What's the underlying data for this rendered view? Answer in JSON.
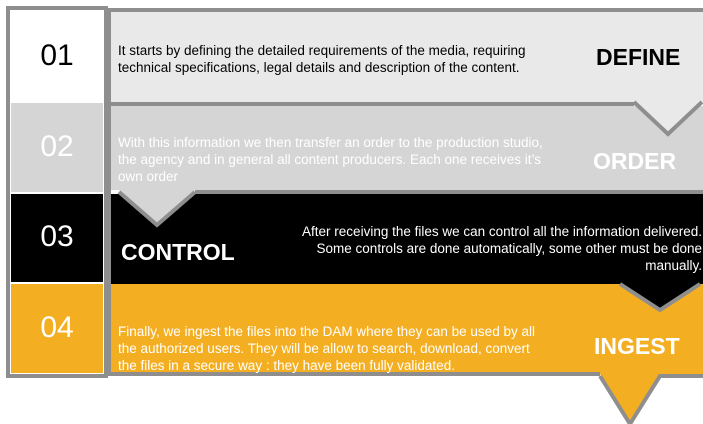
{
  "steps": [
    {
      "number": "01",
      "title": "DEFINE",
      "text": "It starts by defining the detailed requirements of the media, requiring technical specifications, legal details and description of the content."
    },
    {
      "number": "02",
      "title": "ORDER",
      "text": "With this information we then transfer an order to the production studio, the agency and in general all content producers. Each one receives it’s own order"
    },
    {
      "number": "03",
      "title": "CONTROL",
      "text": "After receiving the files we can control all the information delivered. Some controls are done automatically, some other must be done manually."
    },
    {
      "number": "04",
      "title": "INGEST",
      "text": "Finally, we ingest the files into the DAM where they can be used by all the authorized users. They will be allow to search, download, convert the files in a secure way : they have been fully validated."
    }
  ],
  "colors": {
    "define": "#e9e9e9",
    "order": "#d5d5d5",
    "control": "#000000",
    "ingest": "#f4ae22",
    "frame": "#8e8e8e"
  }
}
